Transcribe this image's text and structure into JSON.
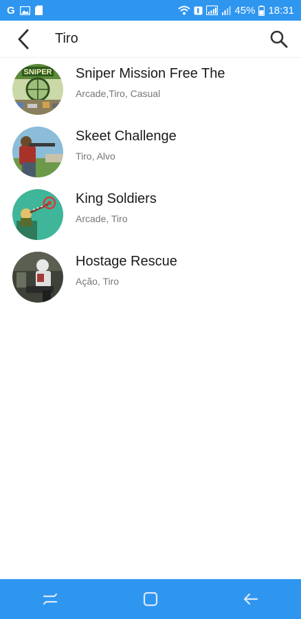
{
  "status_bar": {
    "left_icons": [
      "google-icon",
      "photos-icon",
      "sd-card-icon"
    ],
    "google_glyph": "G",
    "battery_percent": "45%",
    "time": "18:31"
  },
  "search": {
    "query": "Tiro"
  },
  "results": [
    {
      "title": "Sniper Mission Free The",
      "categories": "Arcade,Tiro, Casual",
      "thumb_text": "SNIPER",
      "icon": "sniper-mission-thumbnail"
    },
    {
      "title": "Skeet Challenge",
      "categories": "Tiro, Alvo",
      "icon": "skeet-challenge-thumbnail"
    },
    {
      "title": "King Soldiers",
      "categories": "Arcade, Tiro",
      "icon": "king-soldiers-thumbnail"
    },
    {
      "title": "Hostage Rescue",
      "categories": "Ação, Tiro",
      "icon": "hostage-rescue-thumbnail"
    }
  ],
  "nav_bar": {
    "buttons": [
      "recent-apps-icon",
      "home-icon",
      "back-icon"
    ]
  },
  "colors": {
    "accent": "#2f96f0",
    "title_text": "#1a1a1a",
    "subtitle_text": "#757575"
  }
}
